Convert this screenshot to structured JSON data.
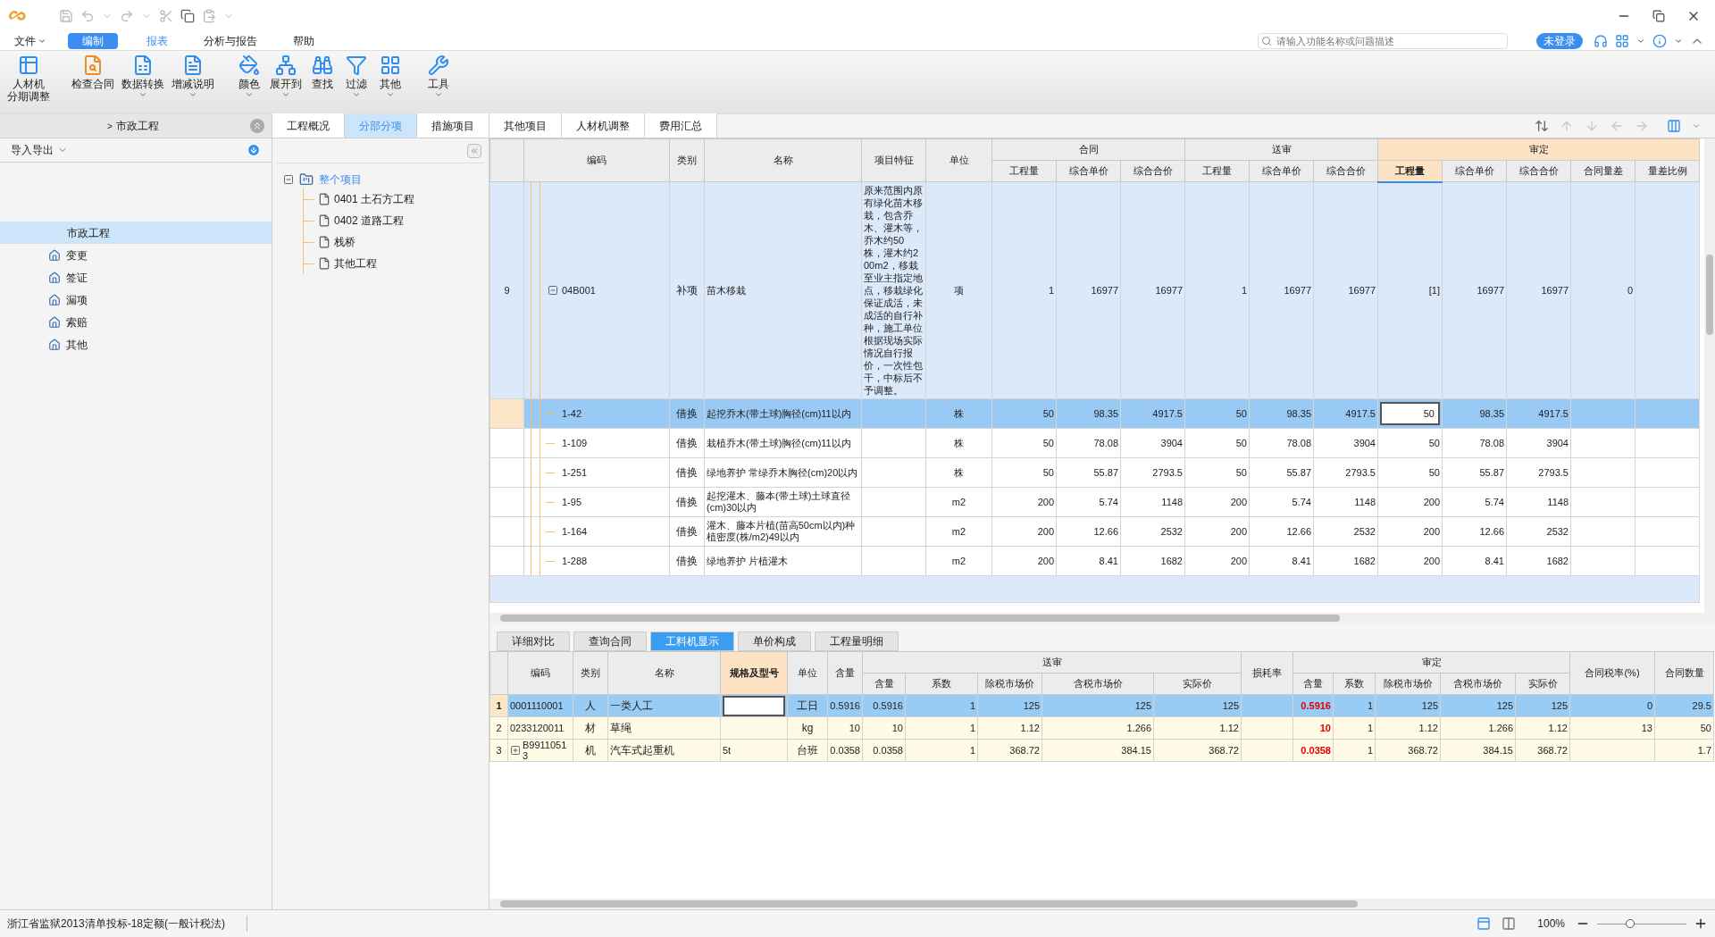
{
  "menu": [
    {
      "label": "文件",
      "selected": false,
      "accent": false,
      "dropdown": true
    },
    {
      "label": "编制",
      "selected": true,
      "accent": false,
      "dropdown": false
    },
    {
      "label": "报表",
      "selected": false,
      "accent": true,
      "dropdown": false
    },
    {
      "label": "分析与报告",
      "selected": false,
      "accent": false,
      "dropdown": false
    },
    {
      "label": "帮助",
      "selected": false,
      "accent": false,
      "dropdown": false
    }
  ],
  "search": {
    "placeholder": "请输入功能名称或问题描述"
  },
  "login_button": "未登录",
  "ribbon": [
    {
      "kind": "schedule",
      "lines": [
        "人材机",
        "分期调整"
      ],
      "menu": false
    },
    {
      "kind": "check",
      "lines": [
        "检查合同"
      ],
      "menu": false
    },
    {
      "kind": "convert",
      "lines": [
        "数据转换"
      ],
      "menu": true
    },
    {
      "kind": "notes",
      "lines": [
        "增减说明"
      ],
      "menu": true
    },
    {
      "kind": "color",
      "lines": [
        "颜色"
      ],
      "menu": true
    },
    {
      "kind": "expand",
      "lines": [
        "展开到"
      ],
      "menu": true
    },
    {
      "kind": "find",
      "lines": [
        "查找"
      ],
      "menu": false
    },
    {
      "kind": "filter",
      "lines": [
        "过滤"
      ],
      "menu": true
    },
    {
      "kind": "other",
      "lines": [
        "其他"
      ],
      "menu": true
    },
    {
      "kind": "tools",
      "lines": [
        "工具"
      ],
      "menu": true
    }
  ],
  "breadcrumb": {
    "separator": ">",
    "current": "市政工程"
  },
  "tabs": [
    {
      "label": "工程概况",
      "selected": false
    },
    {
      "label": "分部分项",
      "selected": true
    },
    {
      "label": "措施项目",
      "selected": false
    },
    {
      "label": "其他项目",
      "selected": false
    },
    {
      "label": "人材机调整",
      "selected": false
    },
    {
      "label": "费用汇总",
      "selected": false
    }
  ],
  "left_panel": {
    "header": "导入导出",
    "items": [
      {
        "label": "市政工程",
        "kind": "project",
        "selected": true
      },
      {
        "label": "变更",
        "kind": "unit",
        "selected": false
      },
      {
        "label": "签证",
        "kind": "unit",
        "selected": false
      },
      {
        "label": "漏项",
        "kind": "unit",
        "selected": false
      },
      {
        "label": "索赔",
        "kind": "unit",
        "selected": false
      },
      {
        "label": "其他",
        "kind": "unit",
        "selected": false
      }
    ]
  },
  "tree": {
    "label": "整个项目",
    "expanded": true,
    "selected": true,
    "children": [
      {
        "label": "0401 土石方工程"
      },
      {
        "label": "0402 道路工程"
      },
      {
        "label": "栈桥"
      },
      {
        "label": "其他工程"
      }
    ]
  },
  "main_table": {
    "columns": [
      {
        "label": "编码",
        "selected": false
      },
      {
        "label": "类别",
        "selected": false
      },
      {
        "label": "名称",
        "selected": false
      },
      {
        "label": "项目特征",
        "selected": false
      },
      {
        "label": "单位",
        "selected": false
      },
      {
        "label": "合同",
        "selected": false,
        "columns": [
          {
            "label": "工程量",
            "selected": false
          },
          {
            "label": "综合单价",
            "selected": false
          },
          {
            "label": "综合合价",
            "selected": false
          }
        ]
      },
      {
        "label": "送审",
        "selected": false,
        "columns": [
          {
            "label": "工程量",
            "selected": false
          },
          {
            "label": "综合单价",
            "selected": false
          },
          {
            "label": "综合合价",
            "selected": false
          }
        ]
      },
      {
        "label": "审定",
        "selected": true,
        "columns": [
          {
            "label": "工程量",
            "selected": true
          },
          {
            "label": "综合单价",
            "selected": false
          },
          {
            "label": "综合合价",
            "selected": false
          },
          {
            "label": "合同量差",
            "selected": false
          },
          {
            "label": "量差比例",
            "selected": false
          }
        ]
      }
    ],
    "rows": [
      {
        "kind": "item",
        "number": "9",
        "code": "04B001",
        "expanded": true,
        "selected": false,
        "editing": false,
        "type": "补项",
        "name": "苗木移栽",
        "feature": "原来范围内原有绿化苗木移栽，包含乔木、灌木等，乔木约50株，灌木约200m2，移栽至业主指定地点，移栽绿化保证成活，未成活的自行补种，施工单位根据现场实际情况自行报价，一次性包干，中标后不予调整。",
        "unit": "项",
        "values": [
          "1",
          "16977",
          "16977",
          "1",
          "16977",
          "16977",
          "[1]",
          "16977",
          "16977",
          "0"
        ]
      },
      {
        "kind": "sub",
        "code": "1-42",
        "selected": true,
        "editing": true,
        "type": "借换",
        "name": "起挖乔木(带土球)胸径(cm)11以内",
        "unit": "株",
        "values": [
          "50",
          "98.35",
          "4917.5",
          "50",
          "98.35",
          "4917.5",
          "50",
          "98.35",
          "4917.5"
        ]
      },
      {
        "kind": "sub",
        "code": "1-109",
        "selected": false,
        "editing": false,
        "type": "借换",
        "name": "栽植乔木(带土球)胸径(cm)11以内",
        "unit": "株",
        "values": [
          "50",
          "78.08",
          "3904",
          "50",
          "78.08",
          "3904",
          "50",
          "78.08",
          "3904"
        ]
      },
      {
        "kind": "sub",
        "code": "1-251",
        "selected": false,
        "editing": false,
        "type": "借换",
        "name": "绿地养护 常绿乔木胸径(cm)20以内",
        "unit": "株",
        "values": [
          "50",
          "55.87",
          "2793.5",
          "50",
          "55.87",
          "2793.5",
          "50",
          "55.87",
          "2793.5"
        ]
      },
      {
        "kind": "sub",
        "code": "1-95",
        "selected": false,
        "editing": false,
        "type": "借换",
        "name": "起挖灌木、藤本(带土球)土球直径(cm)30以内",
        "unit": "m2",
        "values": [
          "200",
          "5.74",
          "1148",
          "200",
          "5.74",
          "1148",
          "200",
          "5.74",
          "1148"
        ]
      },
      {
        "kind": "sub",
        "code": "1-164",
        "selected": false,
        "editing": false,
        "type": "借换",
        "name": "灌木、藤本片植(苗高50cm以内)种植密度(株/m2)49以内",
        "unit": "m2",
        "values": [
          "200",
          "12.66",
          "2532",
          "200",
          "12.66",
          "2532",
          "200",
          "12.66",
          "2532"
        ]
      },
      {
        "kind": "sub",
        "code": "1-288",
        "selected": false,
        "editing": false,
        "type": "借换",
        "name": "绿地养护 片植灌木",
        "unit": "m2",
        "values": [
          "200",
          "8.41",
          "1682",
          "200",
          "8.41",
          "1682",
          "200",
          "8.41",
          "1682"
        ]
      }
    ]
  },
  "bottom_tabs": [
    {
      "label": "详细对比",
      "selected": false
    },
    {
      "label": "查询合同",
      "selected": false
    },
    {
      "label": "工料机显示",
      "selected": true
    },
    {
      "label": "单价构成",
      "selected": false
    },
    {
      "label": "工程量明细",
      "selected": false
    }
  ],
  "bottom_table": {
    "columns": [
      {
        "label": "编码",
        "selected": false
      },
      {
        "label": "类别",
        "selected": false
      },
      {
        "label": "名称",
        "selected": false
      },
      {
        "label": "规格及型号",
        "selected": true
      },
      {
        "label": "单位",
        "selected": false
      },
      {
        "label": "含量",
        "selected": false
      },
      {
        "label": "送审",
        "selected": false,
        "columns": [
          {
            "label": "含量",
            "selected": false
          },
          {
            "label": "系数",
            "selected": false
          },
          {
            "label": "除税市场价",
            "selected": false
          },
          {
            "label": "含税市场价",
            "selected": false
          },
          {
            "label": "实际价",
            "selected": false
          }
        ]
      },
      {
        "label": "损耗率",
        "selected": false
      },
      {
        "label": "审定",
        "selected": false,
        "columns": [
          {
            "label": "含量",
            "selected": false
          },
          {
            "label": "系数",
            "selected": false
          },
          {
            "label": "除税市场价",
            "selected": false
          },
          {
            "label": "含税市场价",
            "selected": false
          },
          {
            "label": "实际价",
            "selected": false
          }
        ]
      },
      {
        "label": "合同税率(%)",
        "selected": false
      },
      {
        "label": "合同数量",
        "selected": false
      }
    ],
    "rows": [
      {
        "kind": "leaf",
        "number": "1",
        "code": "0001110001",
        "type": "人",
        "name": "一类人工",
        "unit": "工日",
        "content": "0.5916",
        "selected": true,
        "editing": true,
        "audit_changed": true,
        "submitted": [
          "0.5916",
          "1",
          "125",
          "125",
          "125"
        ],
        "audited": [
          "0.5916",
          "1",
          "125",
          "125",
          "125"
        ],
        "tax_rate": "0",
        "contract_qty": "29.5"
      },
      {
        "kind": "leaf",
        "number": "2",
        "code": "0233120011",
        "type": "材",
        "name": "草绳",
        "unit": "kg",
        "content": "10",
        "selected": false,
        "editing": false,
        "audit_changed": true,
        "submitted": [
          "10",
          "1",
          "1.12",
          "1.266",
          "1.12"
        ],
        "audited": [
          "10",
          "1",
          "1.12",
          "1.266",
          "1.12"
        ],
        "tax_rate": "13",
        "contract_qty": "50"
      },
      {
        "kind": "group",
        "number": "3",
        "code": "B99110513",
        "type": "机",
        "name": "汽车式起重机",
        "spec": "5t",
        "unit": "台班",
        "content": "0.0358",
        "selected": false,
        "editing": false,
        "audit_changed": true,
        "submitted": [
          "0.0358",
          "1",
          "368.72",
          "384.15",
          "368.72"
        ],
        "audited": [
          "0.0358",
          "1",
          "368.72",
          "384.15",
          "368.72"
        ],
        "contract_qty": "1.7"
      }
    ]
  },
  "status_bar": {
    "text": "浙江省监狱2013清单投标-18定额(一般计税法)",
    "zoom": "100%",
    "zoom_slider": {
      "level": 0.37
    }
  }
}
